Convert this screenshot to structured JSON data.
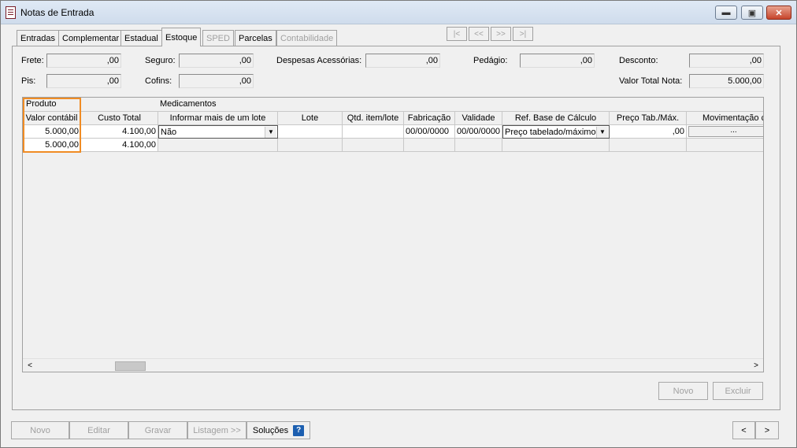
{
  "window": {
    "title": "Notas de Entrada",
    "minimize_label": "▬",
    "restore_label": "▣",
    "close_label": "✕"
  },
  "tabs": [
    {
      "label": "Entradas",
      "state": "normal"
    },
    {
      "label": "Complementar",
      "state": "normal"
    },
    {
      "label": "Estadual",
      "state": "normal"
    },
    {
      "label": "Estoque",
      "state": "active"
    },
    {
      "label": "SPED",
      "state": "disabled"
    },
    {
      "label": "Parcelas",
      "state": "normal"
    },
    {
      "label": "Contabilidade",
      "state": "disabled"
    }
  ],
  "record_nav": {
    "first_label": "|<",
    "prev_label": "<<",
    "next_label": ">>",
    "last_label": ">|"
  },
  "summary": {
    "frete_label": "Frete:",
    "frete_value": ",00",
    "seguro_label": "Seguro:",
    "seguro_value": ",00",
    "despesas_label": "Despesas Acessórias:",
    "despesas_value": ",00",
    "pedagio_label": "Pedágio:",
    "pedagio_value": ",00",
    "desconto_label": "Desconto:",
    "desconto_value": ",00",
    "pis_label": "Pis:",
    "pis_value": ",00",
    "cofins_label": "Cofins:",
    "cofins_value": ",00",
    "valor_total_label": "Valor Total Nota:",
    "valor_total_value": "5.000,00"
  },
  "grid": {
    "group_produto": "Produto",
    "group_medicamentos": "Medicamentos",
    "columns": [
      "Valor contábil",
      "Custo Total",
      "Informar mais de um lote",
      "Lote",
      "Qtd. item/lote",
      "Fabricação",
      "Validade",
      "Ref. Base de Cálculo",
      "Preço Tab./Máx.",
      "Movimentação c"
    ],
    "row1": {
      "valor_contabil": "5.000,00",
      "custo_total": "4.100,00",
      "informar_lote": "Não",
      "lote": "",
      "qtd": "",
      "fabricacao": "00/00/0000",
      "validade": "00/00/0000",
      "ref_base": "Preço tabelado/máximo",
      "preco_tab": ",00",
      "movimentacao_btn": "..."
    },
    "totals": {
      "valor_contabil": "5.000,00",
      "custo_total": "4.100,00"
    },
    "scroll_left": "<",
    "scroll_right": ">"
  },
  "panel_buttons": {
    "novo": "Novo",
    "excluir": "Excluir"
  },
  "footer": {
    "novo": "Novo",
    "editar": "Editar",
    "gravar": "Gravar",
    "listagem": "Listagem >>",
    "solucoes": "Soluções",
    "help_icon_label": "?",
    "prev": "<",
    "next": ">"
  },
  "colors": {
    "highlight_border": "#f08c24",
    "help_icon_bg": "#1c5fb0"
  }
}
